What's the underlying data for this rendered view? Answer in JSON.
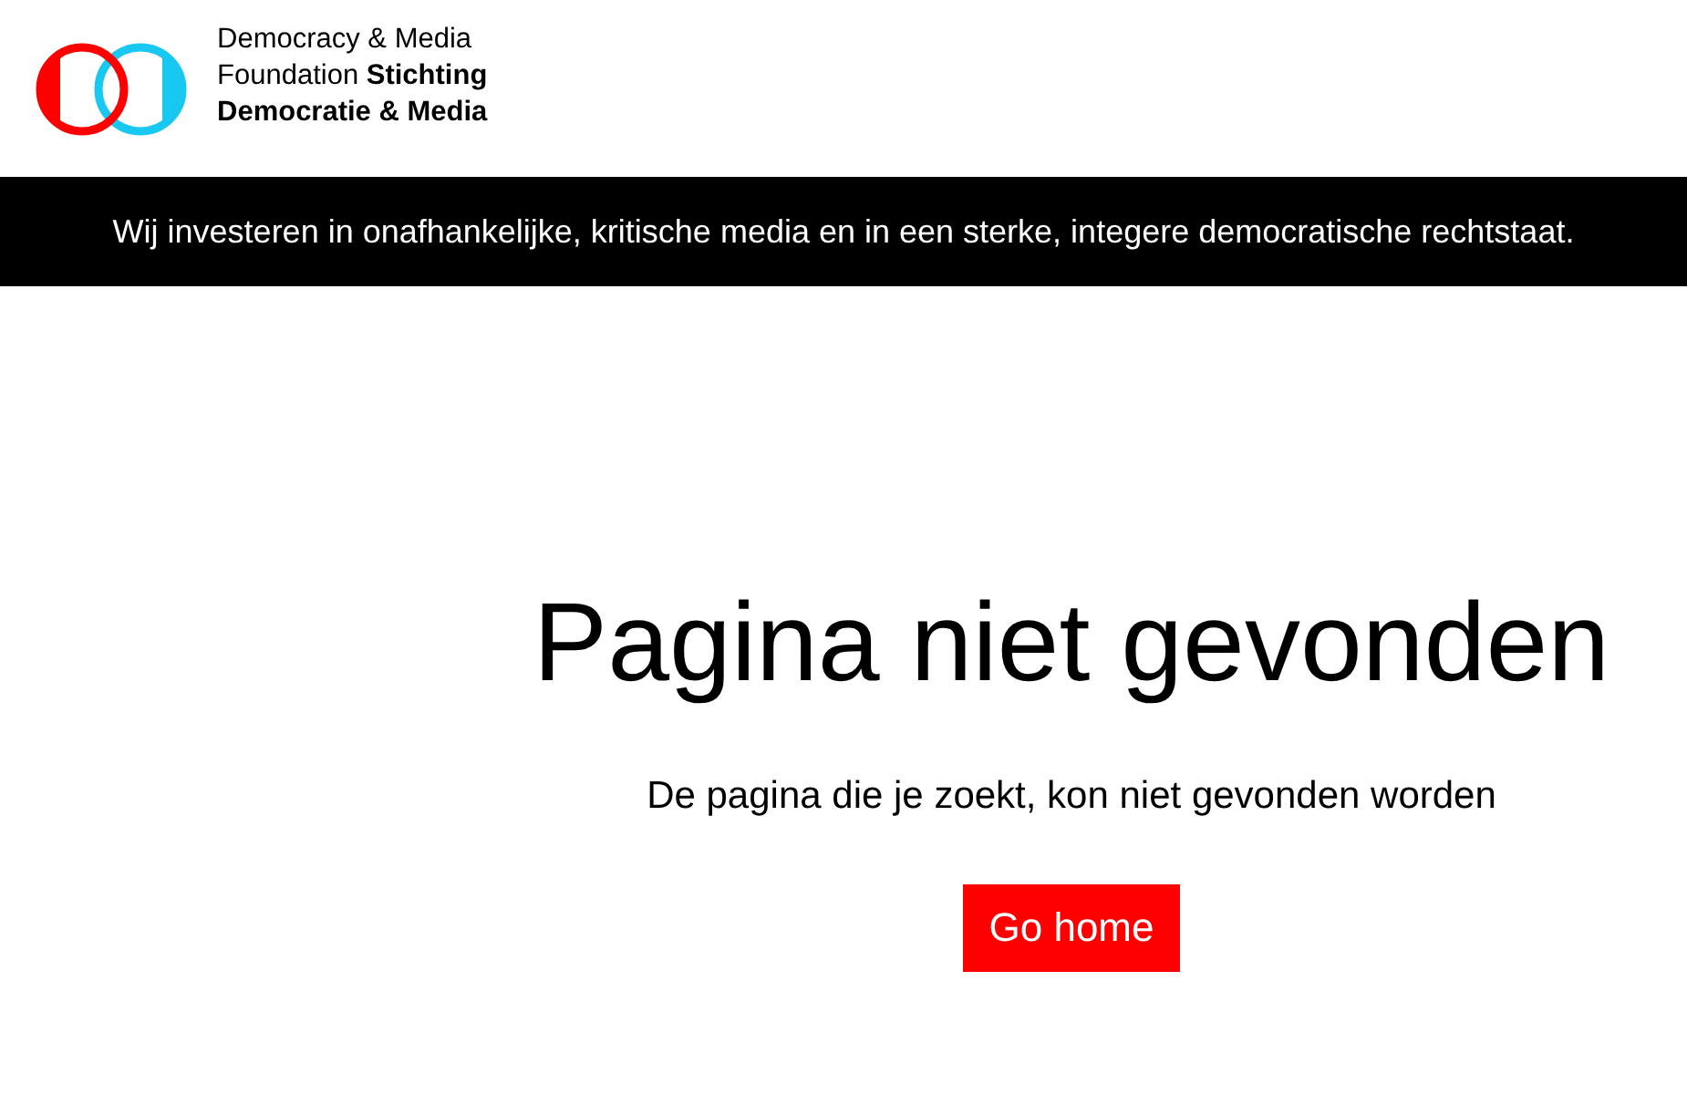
{
  "logo": {
    "lines": [
      "Democracy & Media",
      "Foundation **Stichting**",
      "**Democratie & Media**"
    ]
  },
  "banner": {
    "text": "Wij investeren in onafhankelijke, kritische media en in een sterke, integere democratische rechtstaat."
  },
  "error": {
    "title": "Pagina niet gevonden",
    "message": "De pagina die je zoekt, kon niet gevonden worden",
    "button": "Go home"
  }
}
